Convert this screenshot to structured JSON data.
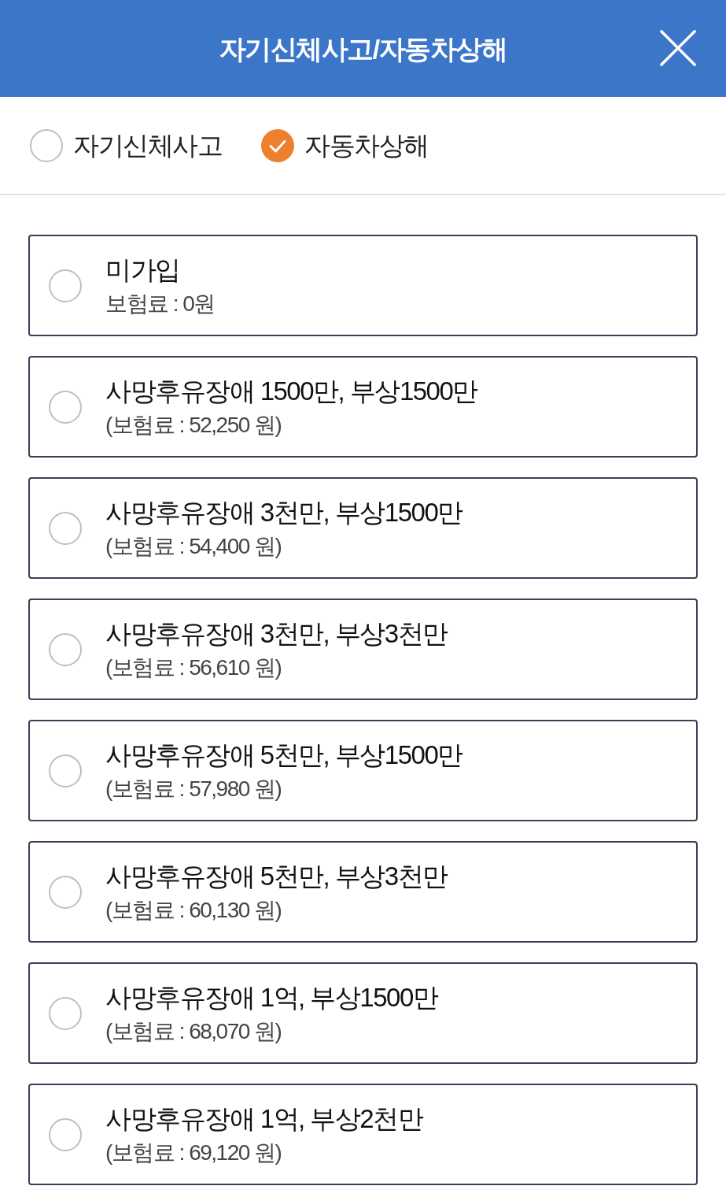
{
  "header": {
    "title": "자기신체사고/자동차상해"
  },
  "coverage_types": [
    {
      "label": "자기신체사고",
      "selected": false
    },
    {
      "label": "자동차상해",
      "selected": true
    }
  ],
  "plans": [
    {
      "name": "미가입",
      "premium": "보험료 : 0원",
      "selected": false
    },
    {
      "name": "사망후유장애 1500만, 부상1500만",
      "premium": "(보험료 : 52,250 원)",
      "selected": false
    },
    {
      "name": "사망후유장애 3천만, 부상1500만",
      "premium": "(보험료 : 54,400 원)",
      "selected": false
    },
    {
      "name": "사망후유장애 3천만, 부상3천만",
      "premium": "(보험료 : 56,610 원)",
      "selected": false
    },
    {
      "name": "사망후유장애 5천만, 부상1500만",
      "premium": "(보험료 : 57,980 원)",
      "selected": false
    },
    {
      "name": "사망후유장애 5천만, 부상3천만",
      "premium": "(보험료 : 60,130 원)",
      "selected": false
    },
    {
      "name": "사망후유장애 1억, 부상1500만",
      "premium": "(보험료 : 68,070 원)",
      "selected": false
    },
    {
      "name": "사망후유장애 1억, 부상2천만",
      "premium": "(보험료 : 69,120 원)",
      "selected": false
    }
  ]
}
